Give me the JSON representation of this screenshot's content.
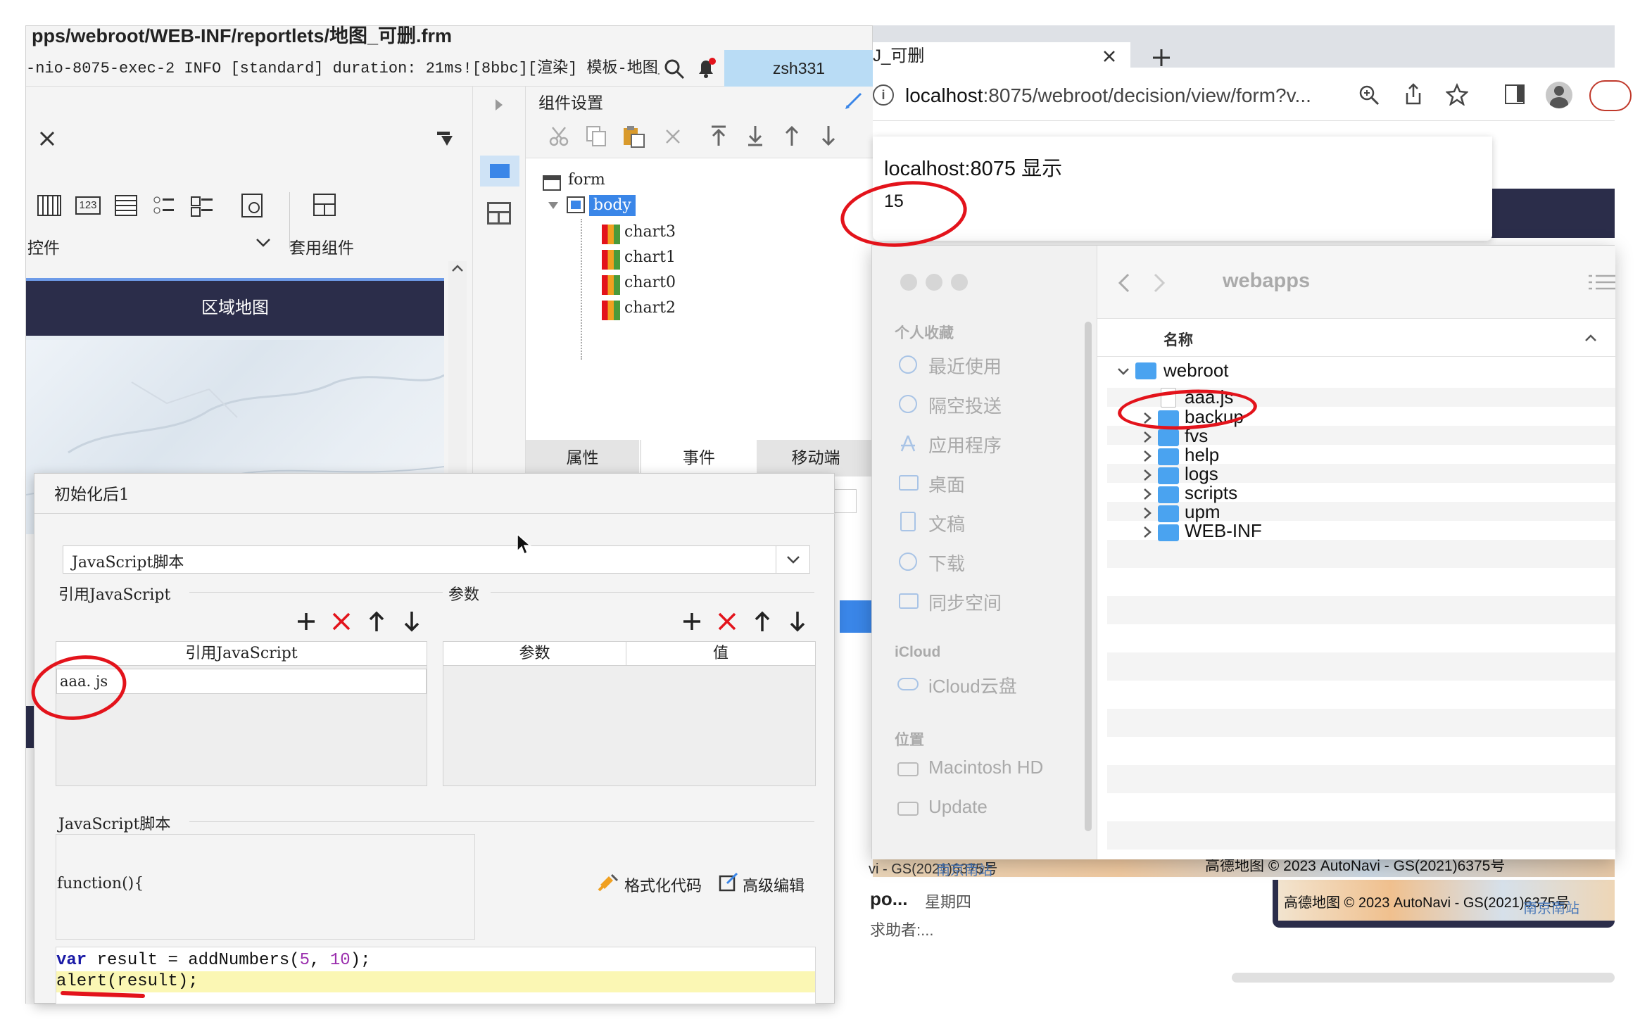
{
  "designer": {
    "title_path": "pps/webroot/WEB-INF/reportlets/地图_可删.frm",
    "log_line": "-nio-8075-exec-2 INFO [standard] duration: 21ms![8bbc][渲染] 模板-地图_...",
    "user": "zsh331",
    "widget_panel": {
      "controls_label": "控件",
      "suite_label": "套用组件",
      "icon_numbers": "123"
    },
    "canvas": {
      "map_title": "区域地图"
    },
    "settings": {
      "title": "组件设置",
      "tree": [
        {
          "label": "form"
        },
        {
          "label": "body"
        },
        {
          "label": "chart3"
        },
        {
          "label": "chart1"
        },
        {
          "label": "chart0"
        },
        {
          "label": "chart2"
        }
      ],
      "tabs": [
        "属性",
        "事件",
        "移动端"
      ]
    },
    "dialog": {
      "title": "初始化后1",
      "type_value": "JavaScript脚本",
      "ref_js_label": "引用JavaScript",
      "param_label": "参数",
      "ref_js_header": "引用JavaScript",
      "param_header": "参数",
      "value_header": "值",
      "ref_js_item": "aaa. js",
      "script_label": "JavaScript脚本",
      "function_open": "function(){",
      "format_code": "格式化代码",
      "advanced_edit": "高级编辑",
      "code": {
        "line1": {
          "kw": "var",
          "rest1": " result = addNumbers(",
          "n1": "5",
          "sep": ", ",
          "n2": "10",
          "rest2": ");"
        },
        "line2": {
          "fn": "alert",
          "rest": "(result);"
        }
      }
    }
  },
  "browser": {
    "tab_title": "J_可删",
    "url_host": "localhost",
    "url_rest": ":8075/webroot/decision/view/form?v...",
    "alert": {
      "title": "localhost:8075 显示",
      "message": "15"
    },
    "map_credit_1": "高德地图 © 2023 AutoNavi - GS(2021)6375号",
    "map_credit_2": "高德地图 © 2023 AutoNavi - GS(2021)6375号",
    "map_place": "南京南站",
    "partial_credit": "vi - GS(2021)6375号",
    "partial_place": "南京南站",
    "bg_text_1": "po...",
    "bg_text_2": "星期四",
    "bg_text_3": "求助者:..."
  },
  "finder": {
    "folder_title": "webapps",
    "sections": {
      "favorites": "个人收藏",
      "icloud": "iCloud",
      "locations": "位置"
    },
    "favorites": [
      "最近使用",
      "隔空投送",
      "应用程序",
      "桌面",
      "文稿",
      "下载",
      "同步空间"
    ],
    "icloud_items": [
      "iCloud云盘"
    ],
    "locations_items": [
      "Macintosh HD",
      "Update"
    ],
    "column_name": "名称",
    "tree": {
      "root": "webroot",
      "file": "aaa.js",
      "folders": [
        "backup",
        "fvs",
        "help",
        "logs",
        "scripts",
        "upm",
        "WEB-INF"
      ]
    }
  },
  "colors": {
    "accent_blue": "#3a86e8",
    "annotation_red": "#e3131b",
    "map_header": "#2b2d4a",
    "folder_blue": "#4aa3f0"
  }
}
